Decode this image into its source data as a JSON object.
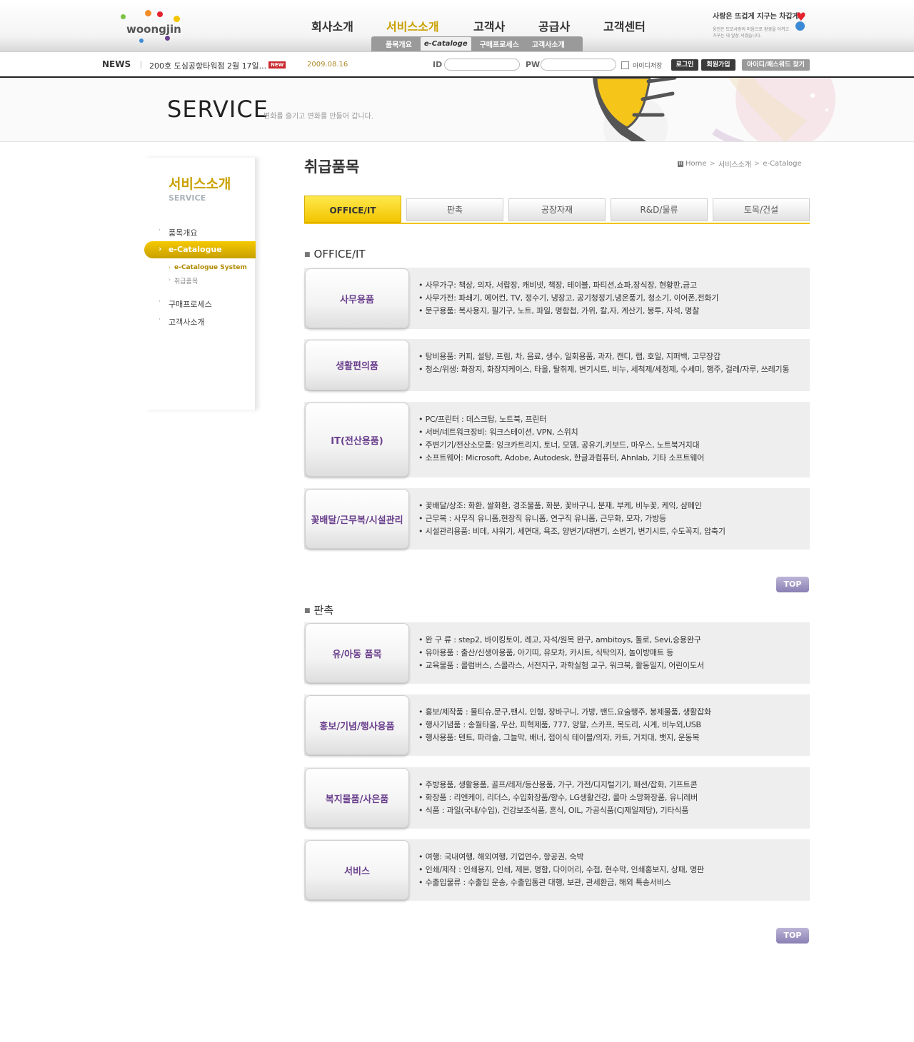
{
  "header": {
    "logo_text": "woongjin",
    "gnb": [
      {
        "label": "회사소개",
        "active": false
      },
      {
        "label": "서비스소개",
        "active": true
      },
      {
        "label": "고객사",
        "active": false
      },
      {
        "label": "공급사",
        "active": false
      },
      {
        "label": "고객센터",
        "active": false
      }
    ],
    "subnav": [
      {
        "label": "품목개요",
        "active": false
      },
      {
        "label": "e-Cataloge",
        "active": true
      },
      {
        "label": "구매프로세스",
        "active": false
      },
      {
        "label": "고객사소개",
        "active": false
      }
    ],
    "slogan_title": "사랑은 뜨겁게 지구는 차갑게",
    "slogan_sub": "웅진은 또또사랑의 마음으로 환경을 아끼고 가꾸는 데 앞장 서겠습니다."
  },
  "newsbar": {
    "label": "NEWS",
    "title": "200호 도심공항타워점 2월 17일...",
    "new_badge": "NEW",
    "date": "2009.08.16",
    "id_label": "ID",
    "pw_label": "PW",
    "save_id_label": "아이디저장",
    "login_btn": "로그인",
    "join_btn": "회원가입",
    "find_btn": "아이디/패스워드 찾기"
  },
  "visual": {
    "title": "SERVICE",
    "subtitle": "변화를 즐기고 변화를 만들어 갑니다."
  },
  "lnb": {
    "title": "서비스소개",
    "subtitle": "SERVICE",
    "items": [
      {
        "label": "품목개요"
      },
      {
        "label": "e-Catalogue"
      },
      {
        "label": "구매프로세스"
      },
      {
        "label": "고객사소개"
      }
    ],
    "subitems": [
      {
        "label": "e-Catalogue System"
      },
      {
        "label": "취급품목"
      }
    ]
  },
  "content": {
    "page_title": "취급품목",
    "breadcrumb": [
      "Home",
      "서비스소개",
      "e-Cataloge"
    ],
    "tabs": [
      "OFFICE/IT",
      "판촉",
      "공장자재",
      "R&D/물류",
      "토목/건설"
    ],
    "top_label": "TOP",
    "sections": [
      {
        "title": "OFFICE/IT",
        "rows": [
          {
            "name": "사무용품",
            "lines": [
              "• 사무가구: 책상, 의자, 서랍장, 캐비넷, 책장, 테이블, 파티션,쇼파,장식장, 현황판,금고",
              "• 사무가전: 파쇄기, 에어컨, TV, 정수기, 냉장고, 공기청정기,냉온풍기, 청소기, 이어폰,전화기",
              "• 문구용품: 복사용지, 필기구, 노트, 파일, 명함첩, 가위, 칼,자,  계산기, 봉투, 자석, 명찰"
            ]
          },
          {
            "name": "생활편의품",
            "lines": [
              "• 탕비용품: 커피, 설탕, 프림, 차, 음료, 생수, 일회용품, 과자, 캔디, 랩, 호일, 지퍼백, 고무장갑",
              "• 청소/위생: 화장지, 화장지케이스, 타올, 탈취제, 변기시트, 비누, 세척제/세정제, 수세미, 행주, 걸레/자루, 쓰레기통"
            ]
          },
          {
            "name": "IT(전산용품)",
            "lines": [
              "• PC/프린터 : 데스크탑, 노트북, 프린터",
              "• 서버/네트워크장비: 워크스테이션, VPN, 스위치",
              "• 주변기기/전산소모품: 잉크카트리지, 토너, 모뎀, 공유기,키보드, 마우스, 노트북거치대",
              "• 소프트웨어: Microsoft, Adobe, Autodesk, 한글과컴퓨터, Ahnlab, 기타 소프트웨어"
            ]
          },
          {
            "name": "꽃배달/근무복/시설관리",
            "lines": [
              "• 꽃배달/상조: 화환,  쌀화환, 경조물품, 화분, 꽃바구니, 분재, 부케, 비누꽃, 케익, 샴페인",
              "• 근무복 : 사무직 유니폼,현장직 유니폼, 연구직 유니폼,  근무화, 모자,  가방등",
              "• 시설관리용품: 비데, 샤워기, 세면대, 욕조, 양변기/대변기, 소변기, 변기시트, 수도꼭지, 압축기"
            ]
          }
        ]
      },
      {
        "title": "판촉",
        "rows": [
          {
            "name": "유/아동 품목",
            "lines": [
              "• 완 구 류 : step2, 바이킹토이, 레고, 자석/원목 완구, ambitoys, 톨로, Sevi,승용완구",
              "• 유아용품 : 출산/신생아용품, 아기띠, 유모차, 카시트, 식탁의자, 놀이방매트 등",
              "• 교육물품 : 콜럼버스, 스콜라스, 서전지구, 과학실험 교구, 워크북, 활동일지, 어린이도서"
            ]
          },
          {
            "name": "홍보/기념/행사용품",
            "lines": [
              "• 홍보/제작품 : 물티슈,문구,팬시,  인형, 장바구니, 가방, 밴드,요술행주, 봉제물품,  생활잡화",
              "• 행사기념품 : 송월타올, 우산, 피혁제품, 777, 양말, 스카프, 목도리, 시계, 비누외,USB",
              "• 행사용품: 텐트, 파라솔, 그늘막, 배너, 접이식 테이블/의자, 카트, 거치대, 뱃지, 운동복"
            ]
          },
          {
            "name": "복지물품/사은품",
            "lines": [
              "• 주방용품, 생활용품, 골프/레저/등산용품, 가구, 가전/디지털기기, 패션/잡화, 기프트콘",
              "• 화장품 : 리엔케이, 리더스, 수입화장품/향수,  LG생활건강, 콜마 소망화장품, 유니레버",
              "• 식품 : 과일(국내/수입), 건강보조식품, 혼식, OIL, 가공식품(CJ제일제당), 기타식품"
            ]
          },
          {
            "name": "서비스",
            "lines": [
              "• 여행: 국내여행, 해외여행, 기업연수, 항공권, 숙박",
              "• 인쇄/제작 : 인쇄용지, 인쇄, 제본, 명함, 다이어리, 수첩,  현수막, 인쇄홍보지, 상패, 명판",
              "• 수출입물류 : 수출입 운송, 수출입통관 대행, 보관, 관세환급, 해외 특송서비스"
            ]
          }
        ]
      }
    ]
  },
  "colors": {
    "accent_yellow": "#f2c400",
    "item_purple": "#6a3f8d",
    "top_btn": "#8a7fb3"
  }
}
